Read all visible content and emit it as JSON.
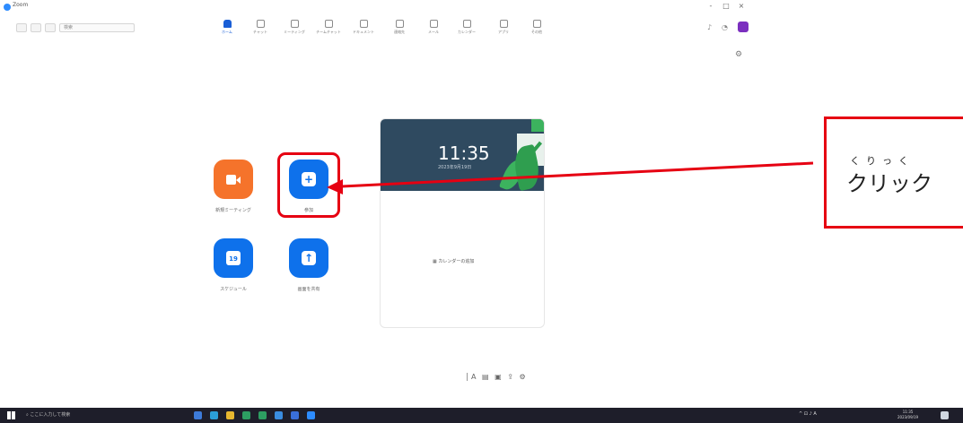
{
  "window": {
    "title": "Zoom",
    "minimize": "-",
    "maximize": "□",
    "close": "×"
  },
  "toolbar": {
    "search_placeholder": "検索",
    "tabs": [
      {
        "label": "ホーム",
        "active": true
      },
      {
        "label": "チャット"
      },
      {
        "label": "ミーティング"
      },
      {
        "label": "チームチャット"
      },
      {
        "label": "ドキュメント"
      },
      {
        "label": "連絡先"
      },
      {
        "label": "メール"
      },
      {
        "label": "カレンダー"
      },
      {
        "label": "アプリ"
      },
      {
        "label": "その他"
      }
    ],
    "right_icons": [
      "notification-icon",
      "settings-icon"
    ]
  },
  "actions": {
    "new_meeting": "新規ミーティング",
    "join": "参加",
    "schedule": "スケジュール",
    "schedule_day": "19",
    "share_screen": "画面を共有"
  },
  "calendar_card": {
    "time": "11:35",
    "date": "2023年9月19日",
    "empty": "カレンダーの追加"
  },
  "callout": {
    "ruby": "くりっく",
    "text": "クリック"
  },
  "taskbar": {
    "search_placeholder": "ここに入力して検索",
    "clock_time": "11:35",
    "clock_date": "2023/09/19",
    "tray_text": "^ ⊡ ♪ A"
  },
  "colors": {
    "zoom_blue": "#0e71eb",
    "zoom_orange": "#f5732b",
    "annotation_red": "#e60012",
    "card_header": "#2f4a60"
  }
}
